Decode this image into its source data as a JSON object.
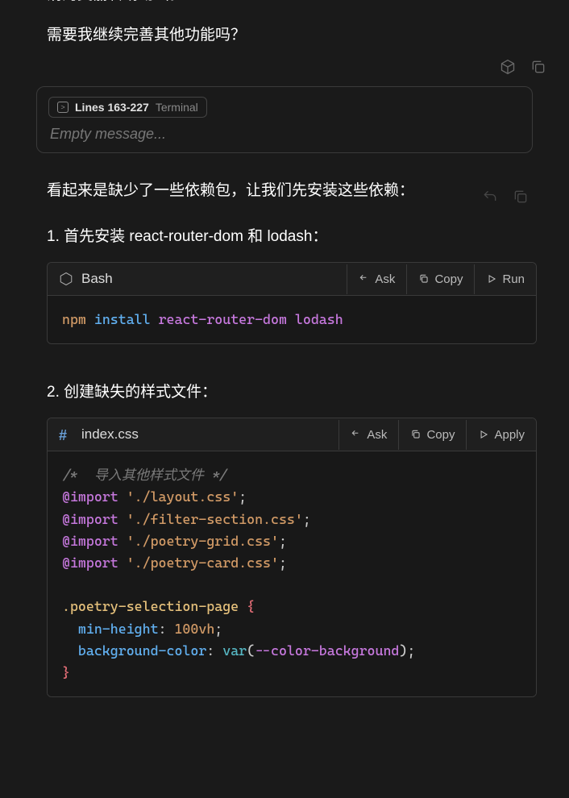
{
  "top": {
    "partial_line": "消的美丽转场动画。",
    "question": "需要我继续完善其他功能吗？"
  },
  "input": {
    "chip_lines": "Lines 163-227",
    "chip_source": "Terminal",
    "placeholder": "Empty message..."
  },
  "response": {
    "intro": "看起来是缺少了一些依赖包，让我们先安装这些依赖：",
    "step1": "1. 首先安装 react-router-dom 和 lodash：",
    "step2": "2. 创建缺失的样式文件："
  },
  "code1": {
    "title": "Bash",
    "actions": {
      "ask": "Ask",
      "copy": "Copy",
      "run": "Run"
    },
    "tokens": {
      "npm": "npm",
      "install": "install",
      "pkg1": "react-router-dom",
      "pkg2": "lodash"
    }
  },
  "code2": {
    "title": "index.css",
    "actions": {
      "ask": "Ask",
      "copy": "Copy",
      "apply": "Apply"
    },
    "tokens": {
      "comment": "/*  导入其他样式文件 */",
      "at": "@import",
      "f1": "'./layout.css'",
      "f2": "'./filter-section.css'",
      "f3": "'./poetry-grid.css'",
      "f4": "'./poetry-card.css'",
      "semi": ";",
      "selector": ".poetry-selection-page",
      "lbrace": "{",
      "rbrace": "}",
      "prop1": "min-height",
      "colon": ":",
      "val1": "100vh",
      "prop2": "background-color",
      "func": "var",
      "lparen": "(",
      "varname": "--color-background",
      "rparen": ")"
    }
  }
}
